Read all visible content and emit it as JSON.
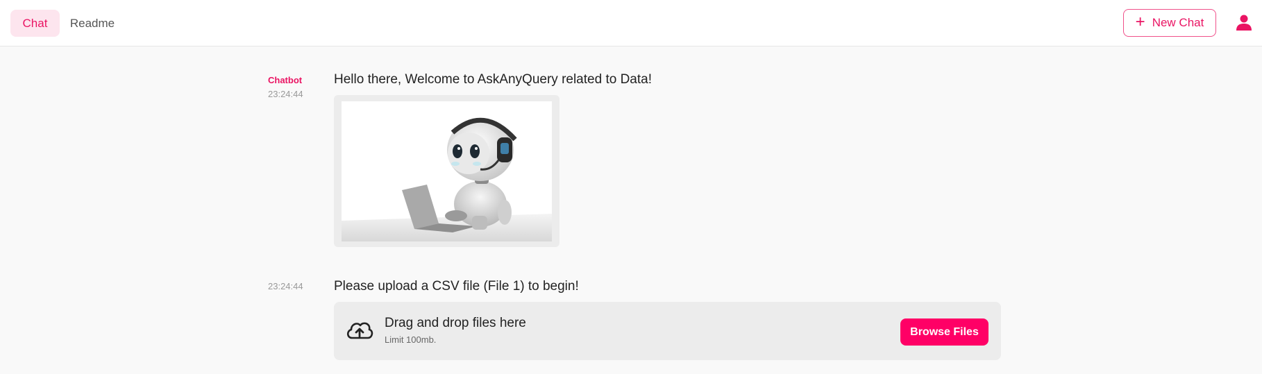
{
  "header": {
    "tabs": [
      {
        "label": "Chat",
        "active": true
      },
      {
        "label": "Readme",
        "active": false
      }
    ],
    "new_chat_label": "New Chat",
    "new_chat_icon": "plus-icon",
    "user_icon": "user-icon",
    "accent_color": "#ea1463"
  },
  "messages": [
    {
      "author": "Chatbot",
      "time": "23:24:44",
      "text": "Hello there, Welcome to AskAnyQuery related to Data!",
      "image": "robot-with-headphones-and-laptop"
    },
    {
      "author": "",
      "time": "23:24:44",
      "text": "Please upload a CSV file (File 1) to begin!"
    }
  ],
  "uploader": {
    "icon": "cloud-upload-icon",
    "title": "Drag and drop files here",
    "limit": "Limit 100mb.",
    "button_label": "Browse Files",
    "button_color": "#ff0066"
  }
}
